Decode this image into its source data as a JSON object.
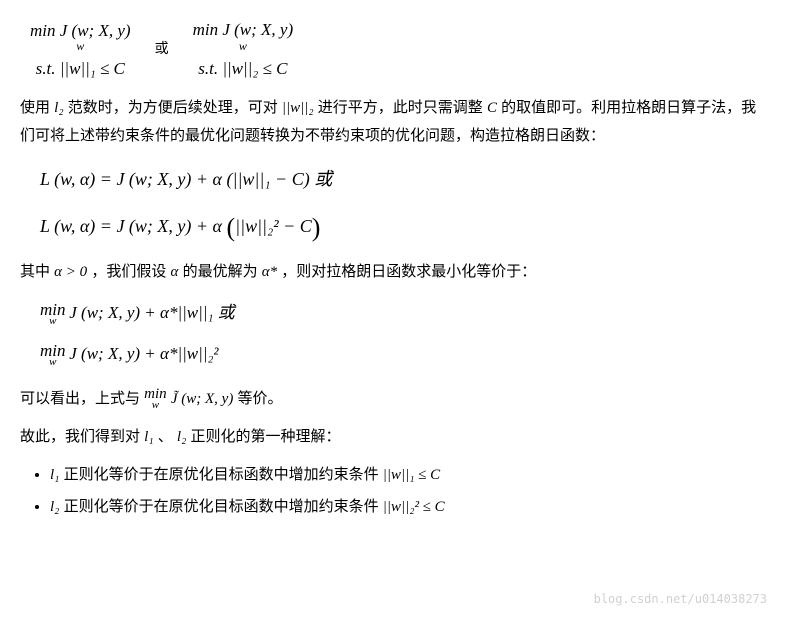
{
  "top_constraints": {
    "left_top": "min J (w; X, y)",
    "left_under": "w",
    "left_st": "s.t. ||w||₁ ≤ C",
    "mid": "或",
    "right_top": "min J (w; X, y)",
    "right_under": "w",
    "right_st": "s.t. ||w||₂ ≤ C"
  },
  "para1": {
    "a": "使用 ",
    "l2": "l₂",
    "b": " 范数时，为方便后续处理，可对 ",
    "w2": "||w||₂",
    "c": " 进行平方，此时只需调整 ",
    "C": "C",
    "d": " 的取值即可。利用拉格朗日算子法，我们可将上述带约束条件的最优化问题转换为不带约束项的优化问题，构造拉格朗日函数："
  },
  "lagrange1": "L (w, α) = J (w; X, y) + α (||w||₁ − C)  或",
  "lagrange2": {
    "pre": "L (w, α) = J (w; X, y) + α ",
    "inner": "||w||₂² − C"
  },
  "para2": {
    "a": "其中 ",
    "alpha_pos": "α > 0",
    "b": " ，我们假设 ",
    "alpha": "α",
    "c": " 的最优解为 ",
    "alpha_star": "α*",
    "d": " ，则对拉格朗日函数求最小化等价于："
  },
  "min1": {
    "min": "min",
    "w": "w",
    "body": " J (w; X, y) + α*||w||₁  或"
  },
  "min2": {
    "min": "min",
    "w": "w",
    "body": " J (w; X, y) + α*||w||₂²"
  },
  "para3": {
    "a": "可以看出，上式与 ",
    "min": "min",
    "w": "w",
    "jtilde": " J̃ (w; X, y)",
    "b": " 等价。"
  },
  "para4": {
    "a": "故此，我们得到对 ",
    "l1": "l₁",
    "sep": " 、 ",
    "l2": "l₂",
    "b": " 正则化的第一种理解："
  },
  "bullets": {
    "b1_a": "l₁",
    "b1_b": " 正则化等价于在原优化目标函数中增加约束条件 ",
    "b1_c": "||w||₁ ≤ C",
    "b2_a": "l₂",
    "b2_b": " 正则化等价于在原优化目标函数中增加约束条件 ",
    "b2_c": "||w||₂² ≤ C"
  },
  "watermark": "blog.csdn.net/u014038273"
}
